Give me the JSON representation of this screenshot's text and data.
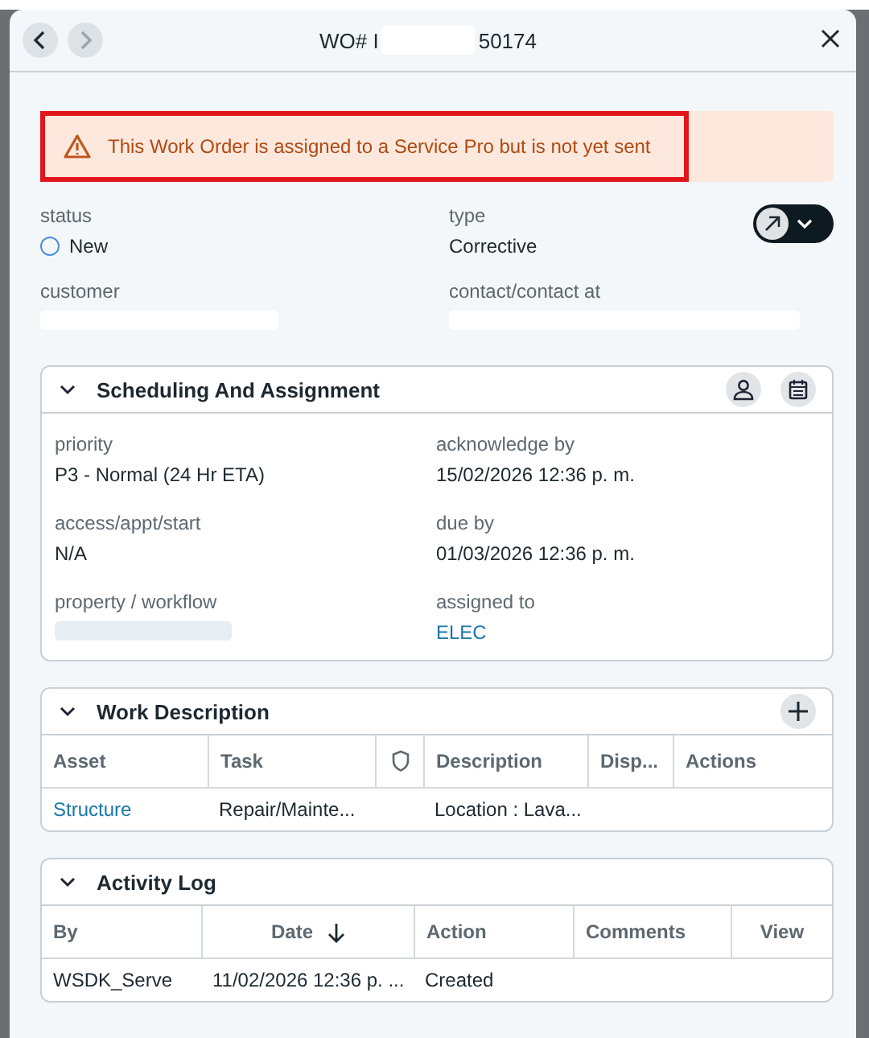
{
  "header": {
    "back": {
      "disabled": false
    },
    "forward": {
      "disabled": true
    },
    "title_start": "WO# I",
    "title_end": "50174"
  },
  "alert": {
    "text": "This Work Order is assigned to a Service Pro but is not yet sent",
    "highlighted": true
  },
  "summary": [
    {
      "label": "status",
      "value": "New",
      "kind": "status"
    },
    {
      "label": "type",
      "value": "Corrective",
      "kind": "text"
    },
    {
      "label": "customer",
      "kind": "redacted"
    },
    {
      "label": "contact/contact at",
      "kind": "redacted"
    }
  ],
  "scheduling": {
    "title": "Scheduling And Assignment",
    "expanded": true,
    "fields": [
      {
        "label": "priority",
        "value": "P3 - Normal (24 Hr ETA)",
        "link": false
      },
      {
        "label": "acknowledge by",
        "value": "15/02/2026 12:36 p. m.",
        "link": false
      },
      {
        "label": "access/appt/start",
        "value": "N/A",
        "link": false
      },
      {
        "label": "due by",
        "value": "01/03/2026 12:36 p. m.",
        "link": false
      },
      {
        "label": "property / workflow",
        "redacted": true
      },
      {
        "label": "assigned to",
        "value": "ELEC",
        "link": true
      }
    ]
  },
  "work_description": {
    "title": "Work Description",
    "expanded": true,
    "columns": [
      {
        "kind": "text",
        "label": "Asset"
      },
      {
        "kind": "text",
        "label": "Task"
      },
      {
        "kind": "icon"
      },
      {
        "kind": "text",
        "label": "Description"
      },
      {
        "kind": "text",
        "label": "Disp..."
      },
      {
        "kind": "text",
        "label": "Actions"
      }
    ],
    "rows": [
      {
        "cells": [
          {
            "text": "Structure",
            "link": true
          },
          {
            "text": "Repair/Mainte...",
            "link": false
          },
          null,
          {
            "text": "Location : Lava...",
            "link": false
          },
          null,
          null
        ]
      }
    ]
  },
  "activity_log": {
    "title": "Activity Log",
    "expanded": true,
    "columns": [
      {
        "label": "By",
        "sorted": false
      },
      {
        "label": "Date",
        "sorted": true
      },
      {
        "label": "Action",
        "sorted": false
      },
      {
        "label": "Comments",
        "sorted": false
      },
      {
        "label": "View",
        "sorted": false
      }
    ],
    "rows": [
      {
        "cells": [
          {
            "text": "WSDK_Serve",
            "link": false
          },
          {
            "text": "11/02/2026 12:36 p. ...",
            "link": false
          },
          {
            "text": "Created",
            "link": false
          },
          null,
          null
        ]
      }
    ]
  }
}
